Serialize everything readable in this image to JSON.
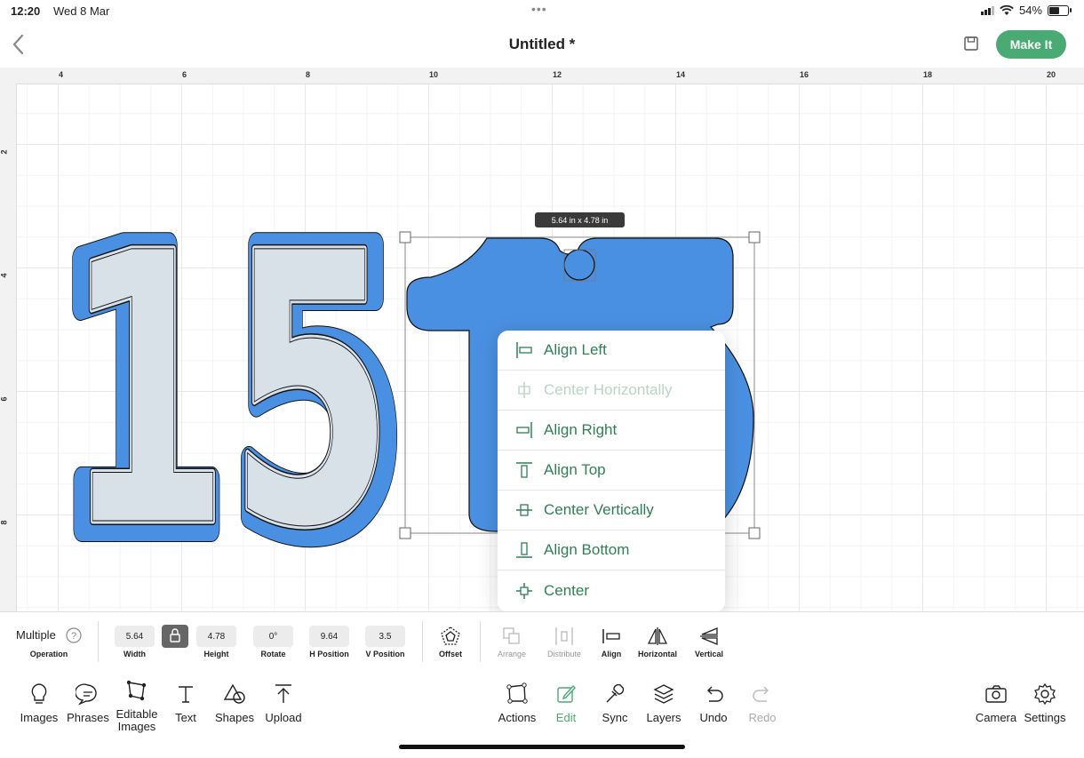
{
  "status_bar": {
    "time": "12:20",
    "date": "Wed 8 Mar",
    "dots": "•••",
    "battery": "54%"
  },
  "header": {
    "title": "Untitled *",
    "make_it_label": "Make It"
  },
  "rulers": {
    "top_ticks": [
      "4",
      "6",
      "8",
      "10",
      "12",
      "14",
      "16",
      "18",
      "20"
    ],
    "left_ticks": [
      "2",
      "4",
      "6",
      "8"
    ]
  },
  "canvas": {
    "size_badge": "5.64 in x 4.78 in",
    "left_text": "15"
  },
  "align_menu": {
    "items": [
      {
        "label": "Align Left",
        "enabled": true
      },
      {
        "label": "Center Horizontally",
        "enabled": false
      },
      {
        "label": "Align Right",
        "enabled": true
      },
      {
        "label": "Align Top",
        "enabled": true
      },
      {
        "label": "Center Vertically",
        "enabled": true
      },
      {
        "label": "Align Bottom",
        "enabled": true
      },
      {
        "label": "Center",
        "enabled": true
      }
    ]
  },
  "edit_toolbar": {
    "operation_value": "Multiple",
    "operation_label": "Operation",
    "width_value": "5.64",
    "width_label": "Width",
    "height_value": "4.78",
    "height_label": "Height",
    "rotate_value": "0°",
    "rotate_label": "Rotate",
    "hpos_value": "9.64",
    "hpos_label": "H Position",
    "vpos_value": "3.5",
    "vpos_label": "V Position",
    "offset_label": "Offset",
    "arrange_label": "Arrange",
    "distribute_label": "Distribute",
    "align_label": "Align",
    "horizontal_label": "Horizontal",
    "vertical_label": "Vertical"
  },
  "bottom_bar": {
    "images": "Images",
    "phrases": "Phrases",
    "editable_images": "Editable Images",
    "text": "Text",
    "shapes": "Shapes",
    "upload": "Upload",
    "actions": "Actions",
    "edit": "Edit",
    "sync": "Sync",
    "layers": "Layers",
    "undo": "Undo",
    "redo": "Redo",
    "camera": "Camera",
    "settings": "Settings"
  },
  "colors": {
    "accent": "#4aaa73",
    "shape_blue": "#4a90e2",
    "shape_light": "#d8e0e8"
  }
}
